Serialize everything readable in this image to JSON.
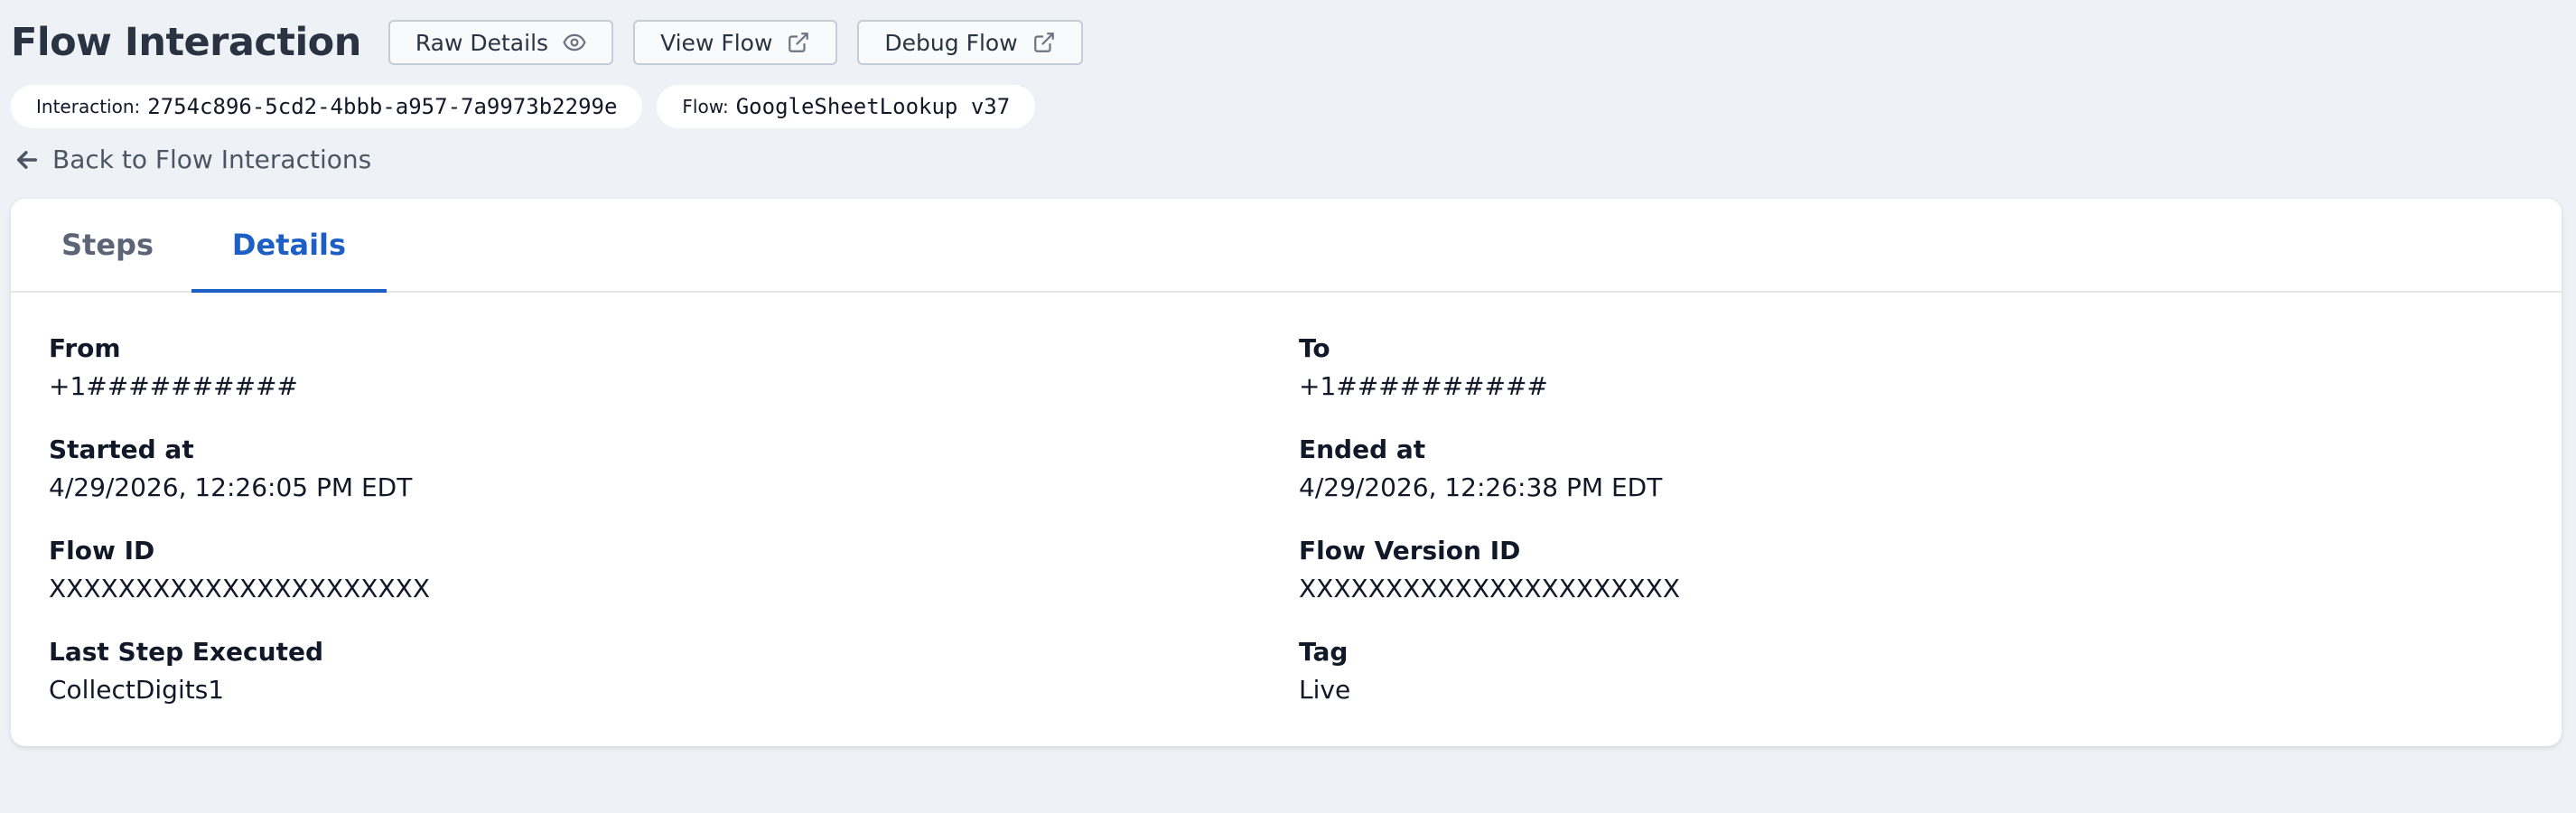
{
  "header": {
    "title": "Flow Interaction",
    "buttons": {
      "raw_details": "Raw Details",
      "view_flow": "View Flow",
      "debug_flow": "Debug Flow"
    }
  },
  "pills": {
    "interaction_label": "Interaction:",
    "interaction_value": "2754c896-5cd2-4bbb-a957-7a9973b2299e",
    "flow_label": "Flow:",
    "flow_value": "GoogleSheetLookup v37"
  },
  "back_link": "Back to Flow Interactions",
  "tabs": {
    "steps": "Steps",
    "details": "Details",
    "active": "Details"
  },
  "details": {
    "from": {
      "label": "From",
      "value": "+1##########"
    },
    "to": {
      "label": "To",
      "value": "+1##########"
    },
    "started_at": {
      "label": "Started at",
      "value": "4/29/2026, 12:26:05 PM EDT"
    },
    "ended_at": {
      "label": "Ended at",
      "value": "4/29/2026, 12:26:38 PM EDT"
    },
    "flow_id": {
      "label": "Flow ID",
      "value": "XXXXXXXXXXXXXXXXXXXXXX"
    },
    "flow_version_id": {
      "label": "Flow Version ID",
      "value": "XXXXXXXXXXXXXXXXXXXXXX"
    },
    "last_step": {
      "label": "Last Step Executed",
      "value": "CollectDigits1"
    },
    "tag": {
      "label": "Tag",
      "value": "Live"
    }
  },
  "colors": {
    "background": "#eef2f6",
    "accent": "#1d5fc4",
    "text": "#111827"
  },
  "icons": {
    "raw_details": "eye-icon",
    "view_flow": "external-link-icon",
    "debug_flow": "external-link-icon",
    "back": "arrow-left-icon"
  }
}
